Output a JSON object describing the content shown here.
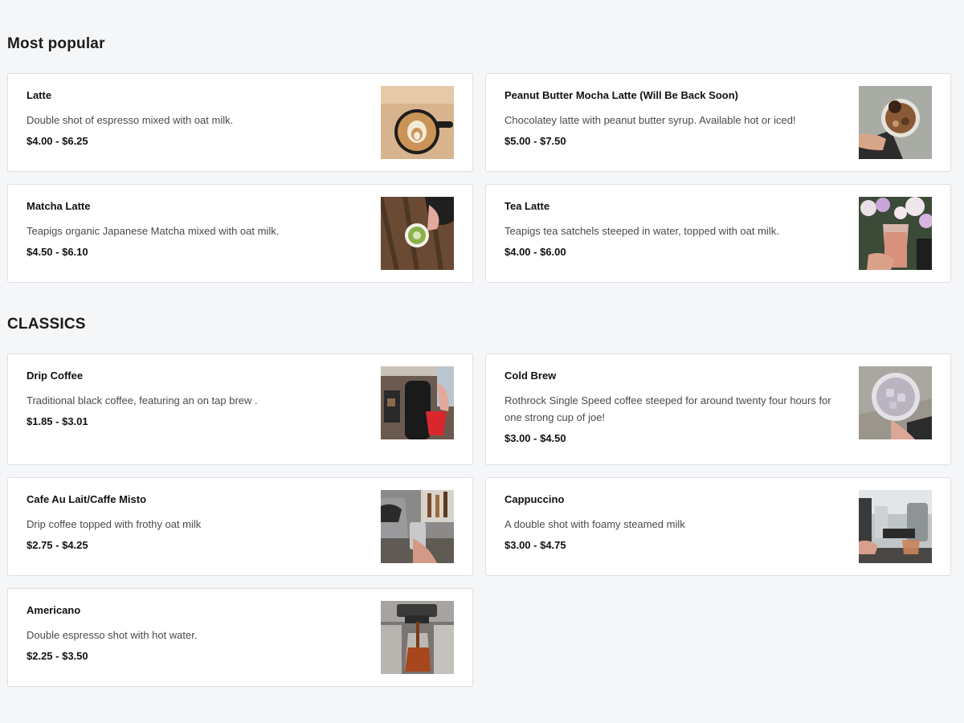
{
  "sections": [
    {
      "title": "Most popular",
      "items": [
        {
          "name": "Latte",
          "description": "Double shot of espresso mixed with oat milk.",
          "price": "$4.00 - $6.25",
          "photo": "latte-art-cup"
        },
        {
          "name": "Peanut Butter Mocha Latte (Will Be Back Soon)",
          "description": "Chocolatey latte with peanut butter syrup. Available hot or iced!",
          "price": "$5.00 - $7.50",
          "photo": "iced-mocha-cup"
        },
        {
          "name": "Matcha Latte",
          "description": "Teapigs organic Japanese Matcha mixed with oat milk.",
          "price": "$4.50 - $6.10",
          "photo": "matcha-cup"
        },
        {
          "name": "Tea Latte",
          "description": "Teapigs tea satchels steeped in water, topped with oat milk.",
          "price": "$4.00 - $6.00",
          "photo": "iced-tea-flowers"
        }
      ]
    },
    {
      "title": "CLASSICS",
      "items": [
        {
          "name": "Drip Coffee",
          "description": "Traditional black coffee, featuring an on tap brew .",
          "price": "$1.85 - $3.01",
          "photo": "drip-brewer"
        },
        {
          "name": "Cold Brew",
          "description": "Rothrock Single Speed coffee steeped for around twenty four hours for one strong cup of joe!",
          "price": "$3.00 - $4.50",
          "photo": "cold-brew-cup"
        },
        {
          "name": "Cafe Au Lait/Caffe Misto",
          "description": "Drip coffee topped with frothy oat milk",
          "price": "$2.75 - $4.25",
          "photo": "milk-steaming"
        },
        {
          "name": "Cappuccino",
          "description": "A double shot with foamy steamed milk",
          "price": "$3.00 - $4.75",
          "photo": "espresso-machine"
        },
        {
          "name": "Americano",
          "description": "Double espresso shot with hot water.",
          "price": "$2.25 - $3.50",
          "photo": "espresso-pour"
        }
      ]
    }
  ],
  "colors": {
    "background": "#f4f6f8",
    "card": "#ffffff",
    "border": "#dcdfe3",
    "text": "#1a1a1a",
    "muted": "#4a4a4a"
  }
}
